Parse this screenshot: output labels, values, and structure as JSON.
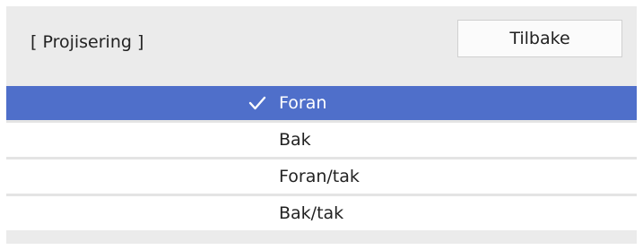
{
  "header": {
    "title": "[ Projisering ]",
    "back_label": "Tilbake"
  },
  "options": [
    {
      "label": "Foran",
      "selected": true
    },
    {
      "label": "Bak",
      "selected": false
    },
    {
      "label": "Foran/tak",
      "selected": false
    },
    {
      "label": "Bak/tak",
      "selected": false
    }
  ],
  "colors": {
    "selected_background": "#4f6fca",
    "panel_background": "#ebebeb",
    "option_background": "#ffffff"
  },
  "icons": {
    "selected_marker": "checkmark-icon"
  }
}
